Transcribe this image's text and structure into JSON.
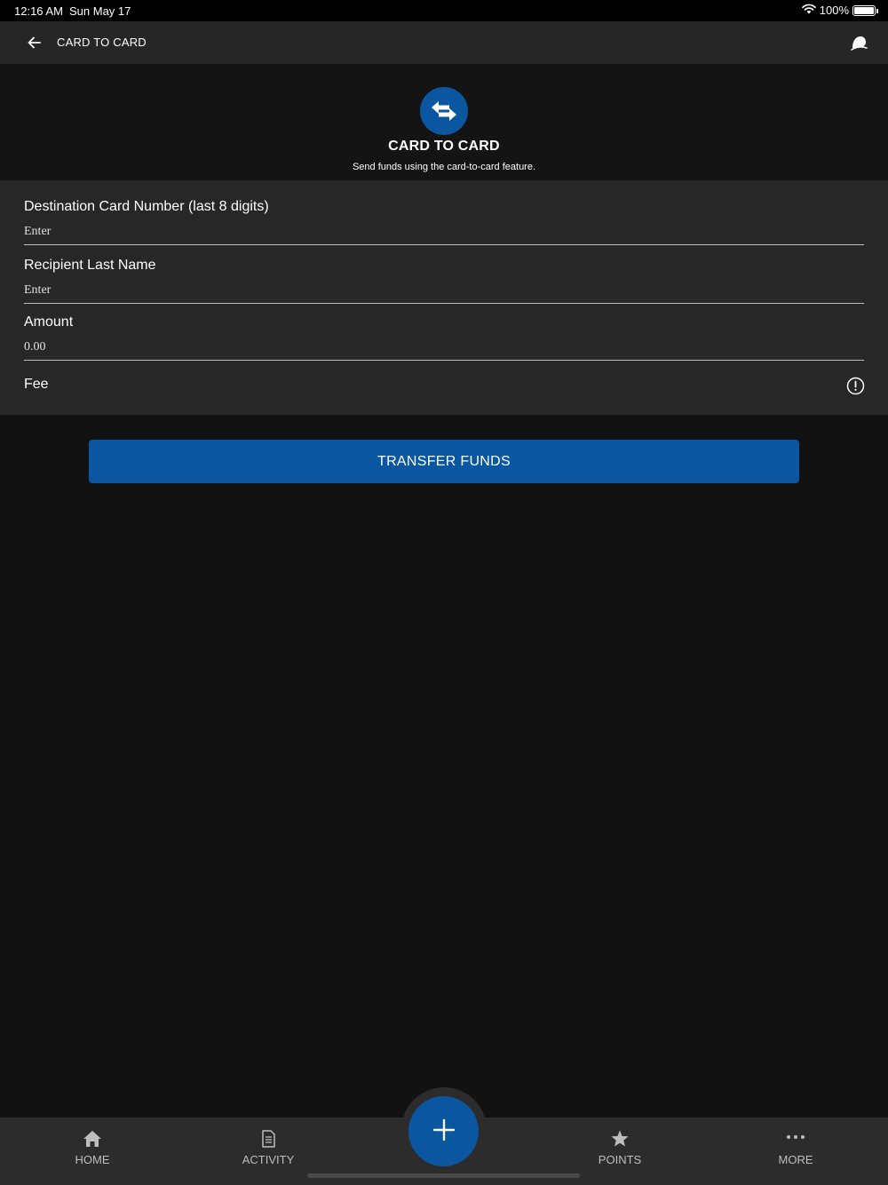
{
  "status_bar": {
    "time": "12:16 AM",
    "date": "Sun May 17",
    "battery": "100%",
    "battery_level": 1.0
  },
  "app_bar": {
    "title": "CARD TO CARD",
    "back_icon": "arrow-left-icon",
    "logo_icon": "bell-logo-icon"
  },
  "hero": {
    "icon": "swap-arrows-icon",
    "title": "CARD TO CARD",
    "subtitle": "Send funds using the card-to-card feature."
  },
  "form": {
    "card_number": {
      "label": "Destination Card Number (last 8 digits)",
      "placeholder": "Enter",
      "value": ""
    },
    "last_name": {
      "label": "Recipient Last Name",
      "placeholder": "Enter",
      "value": ""
    },
    "amount": {
      "label": "Amount",
      "placeholder": "0.00",
      "value": ""
    },
    "fee": {
      "label": "Fee",
      "info_icon": "info-circle-icon"
    }
  },
  "transfer_button": {
    "label": "TRANSFER FUNDS"
  },
  "bottom_nav": {
    "items": [
      {
        "label": "HOME",
        "icon": "home-icon"
      },
      {
        "label": "ACTIVITY",
        "icon": "document-icon"
      },
      {
        "label": "POINTS",
        "icon": "star-icon"
      },
      {
        "label": "MORE",
        "icon": "more-dots-icon"
      }
    ],
    "fab_icon": "plus-icon"
  },
  "colors": {
    "accent": "#0b56a0",
    "background": "#121212",
    "panel": "#272727",
    "bar": "#262626"
  }
}
